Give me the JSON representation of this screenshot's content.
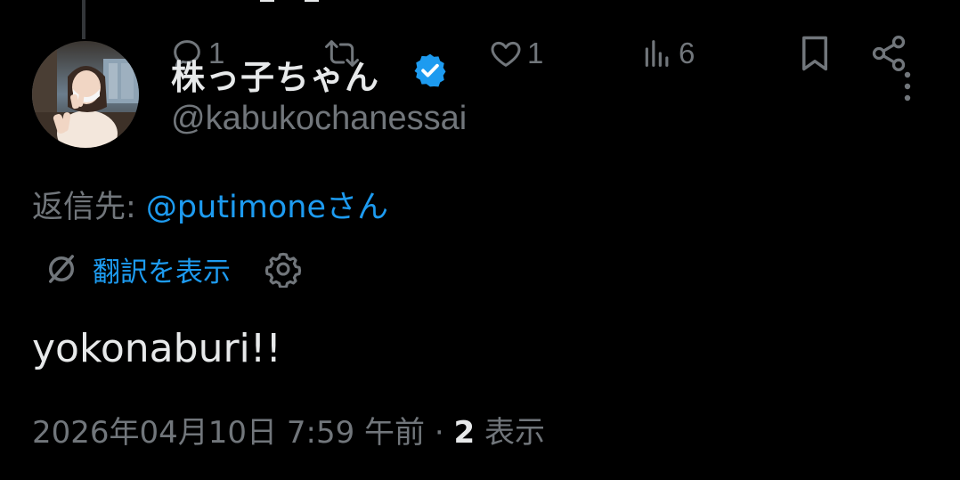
{
  "tweet": {
    "author": {
      "display_name": "株っ子ちゃん",
      "handle": "@kabukochanessai",
      "verified": true,
      "avatar_icon": "user-avatar-photo"
    },
    "reply_to": {
      "prefix": "返信先: ",
      "mention": "@putimoneさん"
    },
    "translate": {
      "label": "翻訳を表示",
      "icon": "translate-icon",
      "settings_icon": "gear-icon"
    },
    "text": "yokonaburi!!",
    "meta": {
      "timestamp": "2026年04月10日 7:59 午前",
      "separator": " · ",
      "views_count": "2",
      "views_label": " 表示"
    },
    "actions": {
      "reply_count": "1",
      "repost_count": "",
      "like_count": "1",
      "views_count": "6",
      "icons": [
        "reply-icon",
        "repost-icon",
        "like-icon",
        "views-icon",
        "bookmark-icon",
        "share-icon",
        "more-icon"
      ]
    }
  },
  "colors": {
    "background": "#000000",
    "primary_text": "#e7e9ea",
    "secondary_text": "#71767b",
    "accent": "#1d9bf0"
  }
}
